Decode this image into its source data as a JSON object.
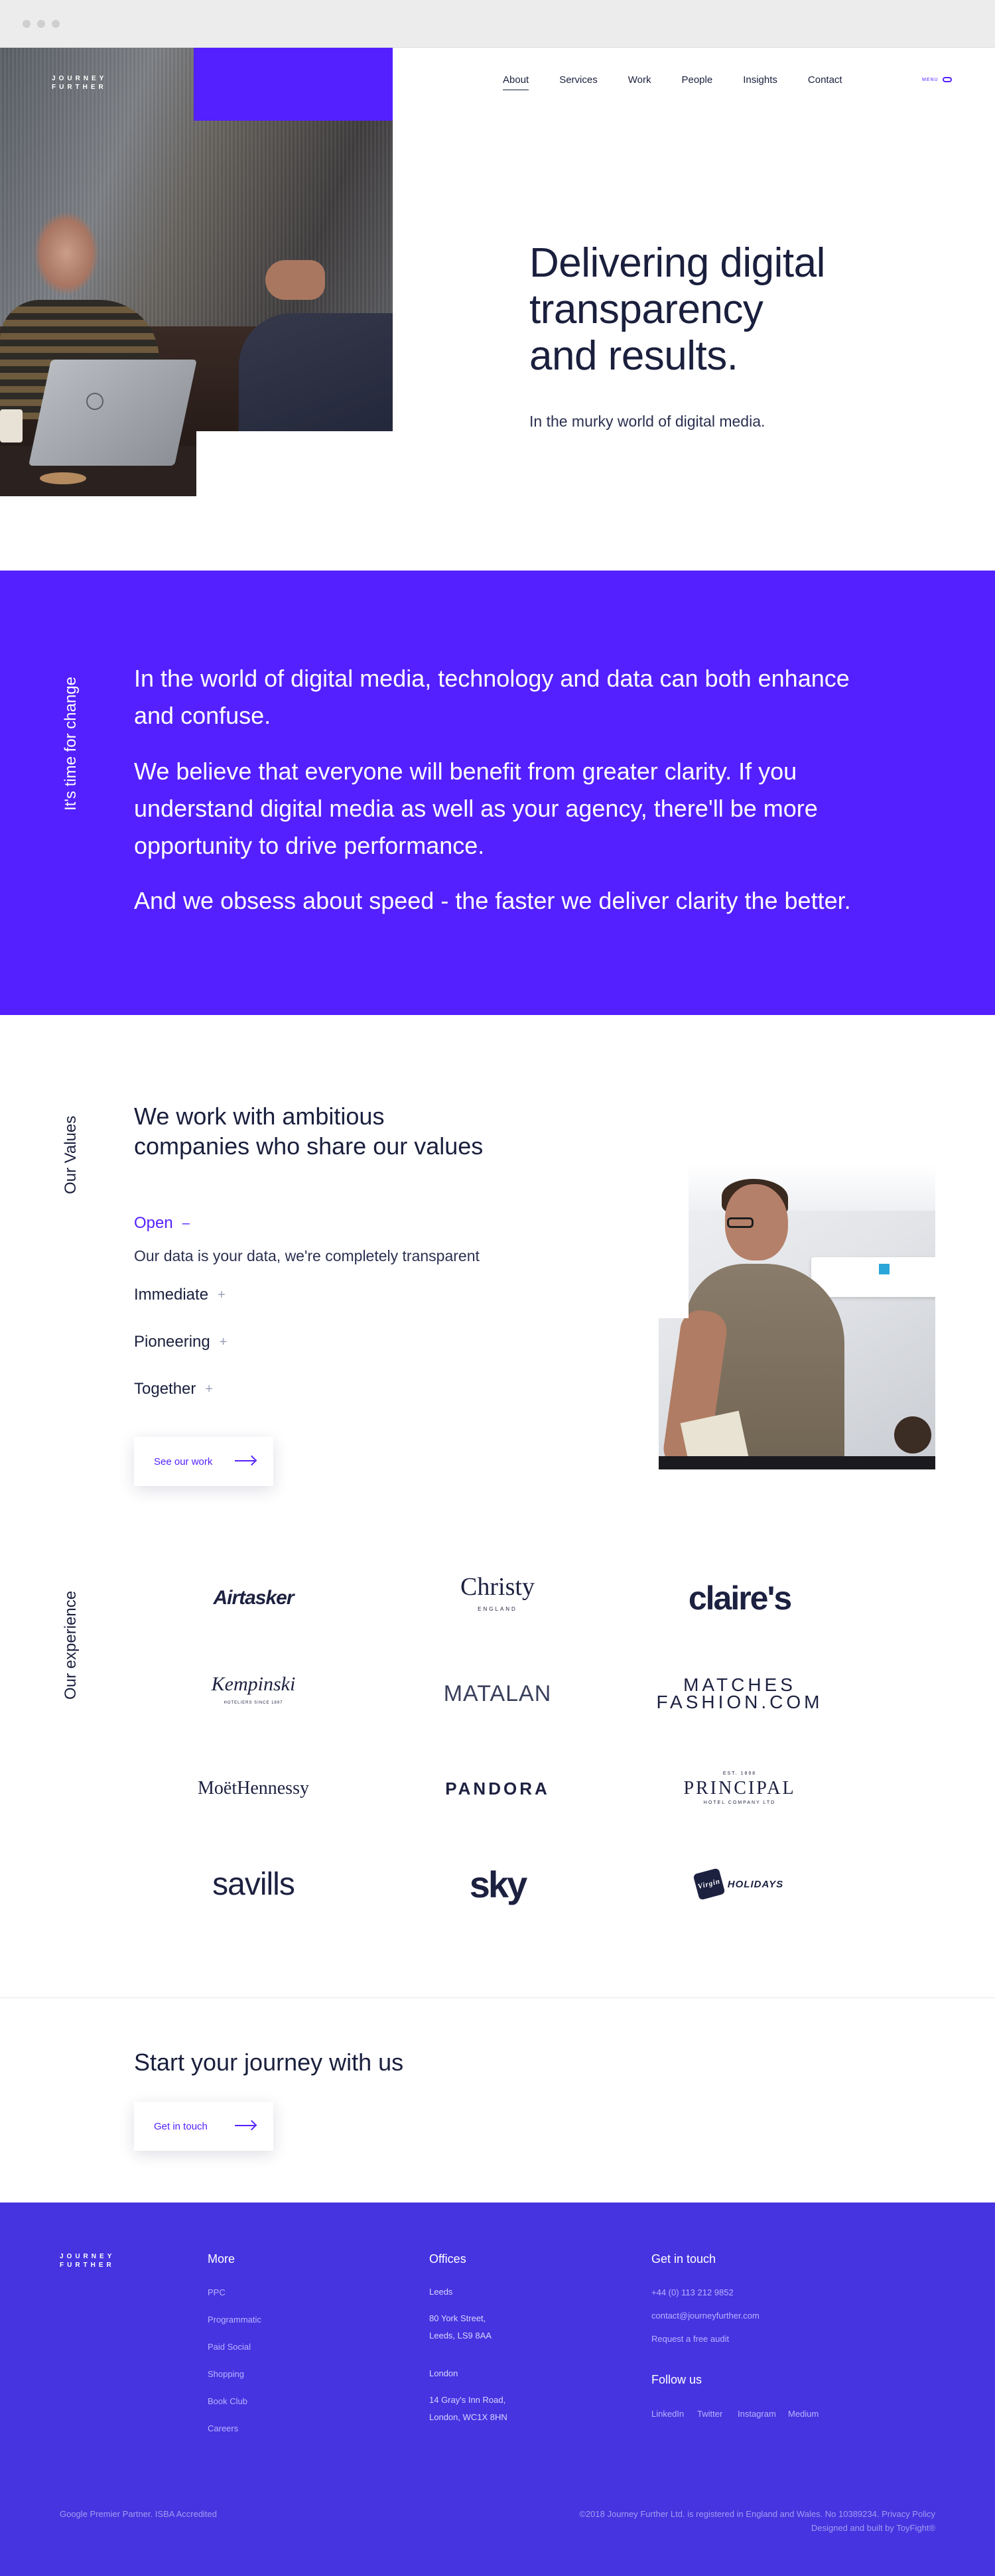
{
  "brand": {
    "logo_line1": "JOURNEY",
    "logo_line2": "FURTHER"
  },
  "nav": {
    "items": [
      {
        "label": "About",
        "active": true
      },
      {
        "label": "Services"
      },
      {
        "label": "Work"
      },
      {
        "label": "People"
      },
      {
        "label": "Insights"
      },
      {
        "label": "Contact"
      }
    ],
    "menu_label": "MENU"
  },
  "hero": {
    "title_l1": "Delivering digital",
    "title_l2": "transparency",
    "title_l3": "and results.",
    "subtitle": "In the murky world of digital media."
  },
  "statement": {
    "label": "It's time for change",
    "paragraphs": [
      "In the world of digital media, technology and data can both enhance and confuse.",
      "We believe that everyone will benefit from greater clarity. If you understand digital media as well as your agency, there'll be more opportunity to drive performance.",
      "And we obsess about speed - the faster we deliver clarity the better."
    ]
  },
  "values": {
    "label": "Our Values",
    "title_l1": "We work with ambitious",
    "title_l2": "companies who share our values",
    "items": [
      {
        "label": "Open",
        "sign": "–",
        "open": true
      },
      {
        "label": "Immediate",
        "sign": "+"
      },
      {
        "label": "Pioneering",
        "sign": "+"
      },
      {
        "label": "Together",
        "sign": "+"
      }
    ],
    "open_description": "Our data is your data, we're completely transparent",
    "button": "See our work"
  },
  "experience": {
    "label": "Our experience",
    "clients": [
      {
        "name": "Airtasker"
      },
      {
        "name": "Christy",
        "sub": "ENGLAND"
      },
      {
        "name": "claire's"
      },
      {
        "name": "Kempinski",
        "sub": "HOTELIERS SINCE 1897"
      },
      {
        "name": "MATALAN"
      },
      {
        "name": "MATCHES",
        "sub": "FASHION.COM"
      },
      {
        "name": "MoëtHennessy"
      },
      {
        "name": "PANDORA"
      },
      {
        "name": "PRINCIPAL",
        "sub": "HOTEL COMPANY LTD",
        "top": "EST. 1898"
      },
      {
        "name": "savills"
      },
      {
        "name": "sky"
      },
      {
        "name": "HOLIDAYS",
        "badge": "Virgin"
      }
    ]
  },
  "cta": {
    "title": "Start your journey with us",
    "button": "Get in touch"
  },
  "footer": {
    "more": {
      "heading": "More",
      "links": [
        "PPC",
        "Programmatic",
        "Paid Social",
        "Shopping",
        "Book Club",
        "Careers"
      ]
    },
    "offices": {
      "heading": "Offices",
      "leeds": "Leeds",
      "leeds_addr1": "80 York Street,",
      "leeds_addr2": "Leeds, LS9 8AA",
      "london": "London",
      "london_addr1": "14 Gray's Inn Road,",
      "london_addr2": "London, WC1X 8HN"
    },
    "contact": {
      "heading": "Get in touch",
      "phone": "+44 (0) 113 212 9852",
      "email": "contact@journeyfurther.com",
      "audit": "Request a free audit"
    },
    "follow": {
      "heading": "Follow us",
      "links": [
        "LinkedIn",
        "Twitter",
        "Instagram",
        "Medium"
      ]
    },
    "partner": "Google Premier Partner. ISBA Accredited",
    "legal1": "©2018 Journey Further Ltd. is registered in England and Wales. No 10389234. Privacy Policy",
    "legal2": "Designed and built by ToyFight®"
  }
}
